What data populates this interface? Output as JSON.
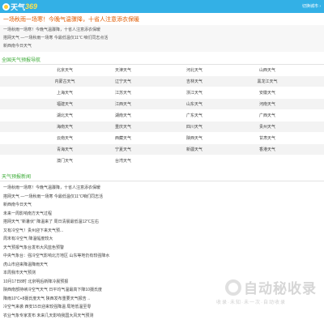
{
  "brand": {
    "logo_text": "天气",
    "logo_num": "369",
    "top_link": "切换城市 ›"
  },
  "headline": "一场秋雨一场寒！今晚气温骤降，十省人注意添衣保暖",
  "intro_lines": [
    "一场秋雨一场寒！今晚气温骤降，十省人注意添衣保暖",
    "搭网天气 —一场秋雨一场寒 今最低温仅11℃ 咱们同志点活",
    "新西南今日天气"
  ],
  "province_section": {
    "title": "全国天气预报导航"
  },
  "provinces": [
    [
      "北京天气",
      "天津天气",
      "河北天气",
      "山西天气"
    ],
    [
      "内蒙古天气",
      "辽宁天气",
      "吉林天气",
      "黑龙江天气"
    ],
    [
      "上海天气",
      "江苏天气",
      "浙江天气",
      "安徽天气"
    ],
    [
      "福建天气",
      "江西天气",
      "山东天气",
      "河南天气"
    ],
    [
      "湖北天气",
      "湖南天气",
      "广东天气",
      "广西天气"
    ],
    [
      "海南天气",
      "重庆天气",
      "四川天气",
      "贵州天气"
    ],
    [
      "云南天气",
      "西藏天气",
      "陕西天气",
      "甘肃天气"
    ],
    [
      "青海天气",
      "宁夏天气",
      "新疆天气",
      "香港天气"
    ],
    [
      "澳门天气",
      "台湾天气",
      "",
      ""
    ]
  ],
  "news_section": {
    "title": "天气预报新闻"
  },
  "news": [
    "一场秋雨一场寒！今晚气温骤降，十省人注意添衣保暖",
    "搭网天气 —一场秋雨一场寒 今最低温仅11℃咱们同志活",
    "新西南今日天气",
    "未来一周影响南方天气过程",
    "搭网天气 “新暑伏” 降温来了 周日清晨最低温12℃左右",
    "又有冷空气！贵州迎下来天气预...",
    "周末有冷空气 降温幅度较大",
    "天气预报气象台发布大风蓝色预警",
    "中央气象台：强冷空气影响北方地区 山东等地仍有较强降水",
    "虎山市迎来降温降雨天气",
    "本周我市天气预测",
    "10月17日8时 北京明后新降冷晨预报",
    "陕西南部持续冷空气天气 日平均气温最高下降10摄氏度",
    "降雨10℃+8摄氏度天气 陕西发布重要天气报告→",
    "冷空气来袭 西安15日迎来较强降温 局地低温至零",
    "农业气象专家发布 未来几天影响我国大风天气预测"
  ],
  "watermark": {
    "main": "自动秘收录",
    "sub": "收录·未知·未一次·自动收录"
  }
}
